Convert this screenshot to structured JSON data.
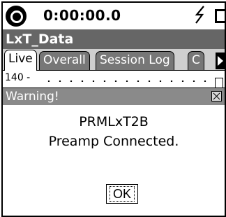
{
  "status": {
    "elapsed_time": "0:00:00.0",
    "logo_icon": "device-logo-icon",
    "power_icon": "lightning-bolt-icon",
    "battery_icon": "battery-icon"
  },
  "app": {
    "title": "LxT_Data"
  },
  "tabs": [
    {
      "label": "Live",
      "active": true
    },
    {
      "label": "Overall",
      "active": false
    },
    {
      "label": "Session Log",
      "active": false
    },
    {
      "label": "C",
      "active": false
    }
  ],
  "chart": {
    "y_tick_label": "140 -"
  },
  "dialog": {
    "title": "Warning!",
    "device_name": "PRMLxT2B",
    "message": "Preamp Connected.",
    "ok_label": "OK"
  },
  "colors": {
    "title_bar": "#666666",
    "tab_inactive": "#777777",
    "dialog_title": "#8a8a8a"
  }
}
